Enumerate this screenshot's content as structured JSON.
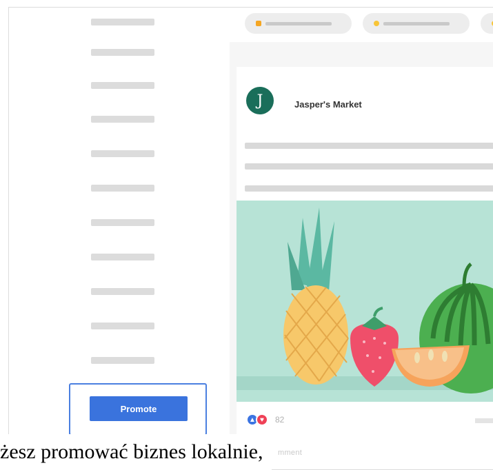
{
  "post": {
    "page_name": "Jasper's Market",
    "avatar_letter": "J",
    "reaction_count": "82"
  },
  "sidebar": {
    "promote_label": "Promote"
  },
  "actions": {
    "comment_partial": "mment"
  },
  "caption": {
    "text": "żesz promować biznes lokalnie,"
  },
  "colors": {
    "promote_blue": "#3a73dd",
    "avatar_green": "#1a6e5a",
    "image_bg": "#b7e3d6",
    "like_blue": "#3b74e2",
    "love_red": "#ef4157",
    "chip_dot_orange": "#f5a623",
    "chip_dot_yellow": "#f8c537"
  },
  "icons": [
    "like-icon",
    "love-icon"
  ]
}
